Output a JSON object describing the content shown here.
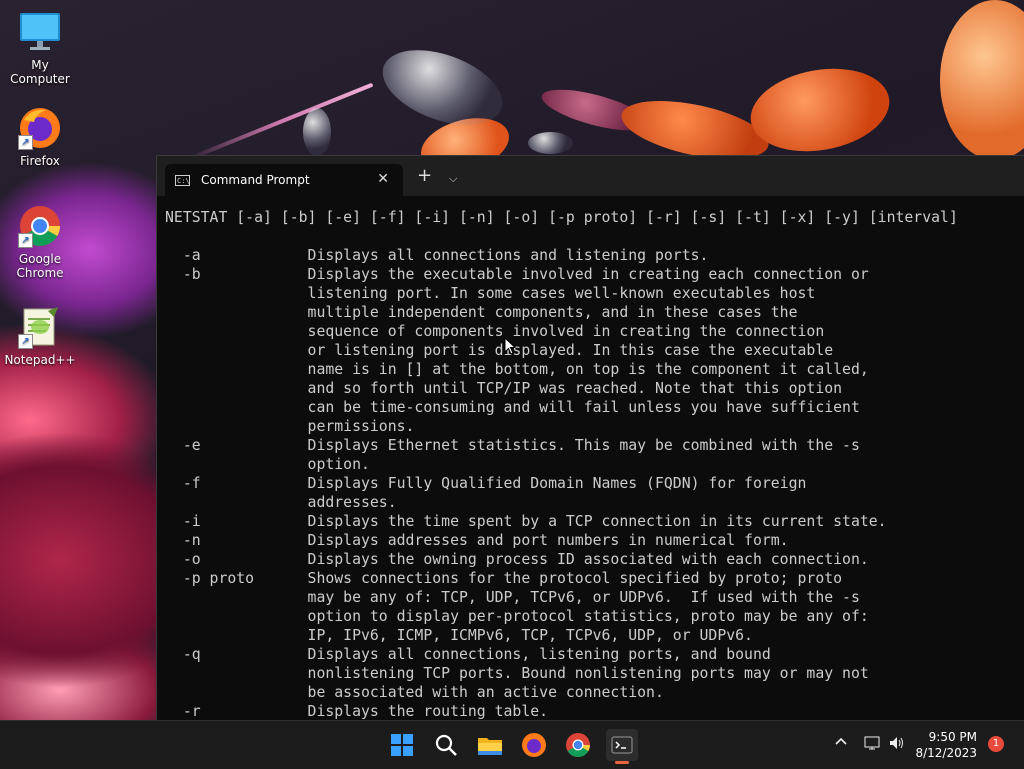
{
  "desktop": {
    "icons": [
      {
        "label": "My Computer",
        "icon": "monitor-icon"
      },
      {
        "label": "Firefox",
        "icon": "firefox-icon"
      },
      {
        "label": "Google Chrome",
        "icon": "chrome-icon"
      },
      {
        "label": "Notepad++",
        "icon": "notepadpp-icon"
      }
    ]
  },
  "terminal": {
    "tab_title": "Command Prompt",
    "tab_icon": "cmd-icon",
    "close_glyph": "✕",
    "new_tab_glyph": "+",
    "dropdown_glyph": "⌵",
    "lines": [
      "NETSTAT [-a] [-b] [-e] [-f] [-i] [-n] [-o] [-p proto] [-r] [-s] [-t] [-x] [-y] [interval]",
      "",
      "  -a            Displays all connections and listening ports.",
      "  -b            Displays the executable involved in creating each connection or",
      "                listening port. In some cases well-known executables host",
      "                multiple independent components, and in these cases the",
      "                sequence of components involved in creating the connection",
      "                or listening port is displayed. In this case the executable",
      "                name is in [] at the bottom, on top is the component it called,",
      "                and so forth until TCP/IP was reached. Note that this option",
      "                can be time-consuming and will fail unless you have sufficient",
      "                permissions.",
      "  -e            Displays Ethernet statistics. This may be combined with the -s",
      "                option.",
      "  -f            Displays Fully Qualified Domain Names (FQDN) for foreign",
      "                addresses.",
      "  -i            Displays the time spent by a TCP connection in its current state.",
      "  -n            Displays addresses and port numbers in numerical form.",
      "  -o            Displays the owning process ID associated with each connection.",
      "  -p proto      Shows connections for the protocol specified by proto; proto",
      "                may be any of: TCP, UDP, TCPv6, or UDPv6.  If used with the -s",
      "                option to display per-protocol statistics, proto may be any of:",
      "                IP, IPv6, ICMP, ICMPv6, TCP, TCPv6, UDP, or UDPv6.",
      "  -q            Displays all connections, listening ports, and bound",
      "                nonlistening TCP ports. Bound nonlistening ports may or may not",
      "                be associated with an active connection.",
      "  -r            Displays the routing table."
    ]
  },
  "taskbar": {
    "apps": [
      "start-icon",
      "search-icon",
      "file-explorer-icon",
      "firefox-icon",
      "chrome-icon",
      "terminal-icon"
    ],
    "tray": {
      "chevron": "^",
      "time": "9:50 PM",
      "date": "8/12/2023",
      "notification_count": "1"
    }
  }
}
